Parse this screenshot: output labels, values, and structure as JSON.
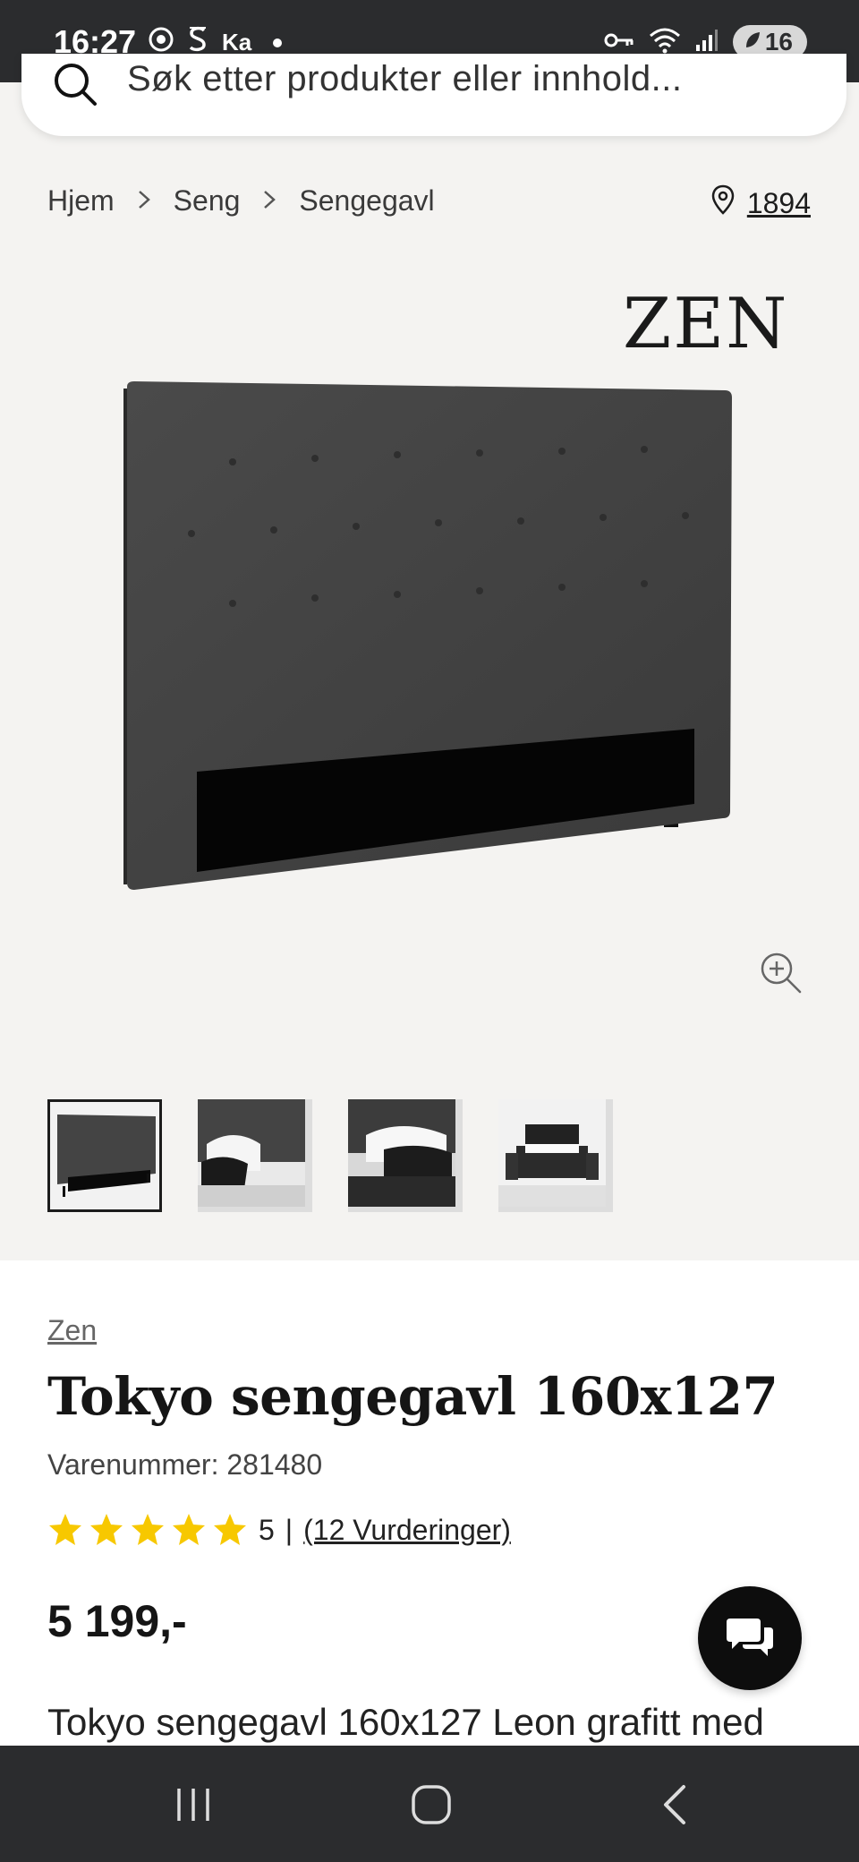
{
  "status_bar": {
    "time": "16:27",
    "carrier_text": "Ka",
    "battery": "16"
  },
  "search": {
    "placeholder": "Søk etter produkter eller innhold..."
  },
  "breadcrumb": {
    "items": [
      "Hjem",
      "Seng",
      "Sengegavl"
    ],
    "store_number": "1894"
  },
  "product": {
    "brand_logo": "ZEN",
    "brand": "Zen",
    "title": "Tokyo sengegavl 160x127",
    "sku": "Varenummer: 281480",
    "rating_value": "5",
    "rating_separator": "|",
    "rating_count": "(12 Vurderinger)",
    "rating_stars": 5,
    "price": "5 199,-",
    "description": "Tokyo sengegavl 160x127 Leon grafitt med"
  },
  "colors": {
    "star": "#f7c800",
    "dark": "#151515",
    "status_bar_bg": "#2b2c2e"
  },
  "icons": {
    "search": "search-icon",
    "location": "location-pin-icon",
    "zoom": "zoom-in-icon",
    "chat": "chat-icon"
  }
}
